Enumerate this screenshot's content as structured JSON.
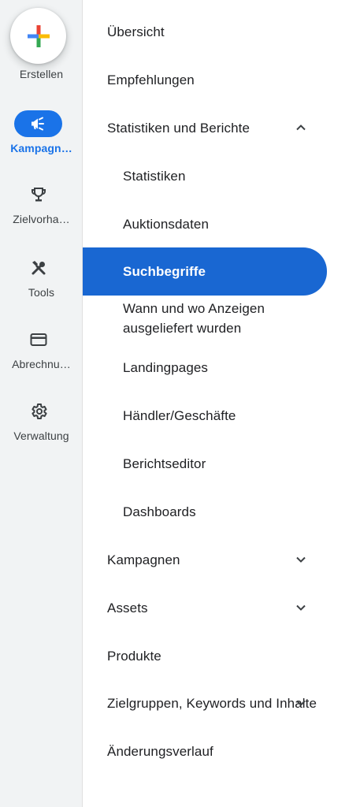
{
  "rail": {
    "create_label": "Erstellen",
    "items": [
      {
        "label": "Kampagn…",
        "icon": "megaphone-icon",
        "active": true
      },
      {
        "label": "Zielvorha…",
        "icon": "trophy-icon",
        "active": false
      },
      {
        "label": "Tools",
        "icon": "tools-icon",
        "active": false
      },
      {
        "label": "Abrechnu…",
        "icon": "credit-card-icon",
        "active": false
      },
      {
        "label": "Verwaltung",
        "icon": "gear-icon",
        "active": false
      }
    ]
  },
  "menu": {
    "items": [
      {
        "label": "Übersicht"
      },
      {
        "label": "Empfehlungen"
      },
      {
        "label": "Statistiken und Berichte",
        "expanded": true
      },
      {
        "label": "Statistiken"
      },
      {
        "label": "Auktionsdaten"
      },
      {
        "label": "Suchbegriffe",
        "selected": true
      },
      {
        "label": "Wann und wo Anzeigen ausgeliefert wurden"
      },
      {
        "label": "Landingpages"
      },
      {
        "label": "Händler/Geschäfte"
      },
      {
        "label": "Berichtseditor"
      },
      {
        "label": "Dashboards"
      },
      {
        "label": "Kampagnen",
        "expanded": false
      },
      {
        "label": "Assets",
        "expanded": false
      },
      {
        "label": "Produkte"
      },
      {
        "label": "Zielgruppen, Keywords und Inhalte",
        "expanded": false
      },
      {
        "label": "Änderungsverlauf"
      }
    ]
  },
  "colors": {
    "accent": "#1a73e8",
    "selected_bg": "#1967d2",
    "rail_bg": "#f1f3f4",
    "google_blue": "#4285f4",
    "google_red": "#ea4335",
    "google_yellow": "#fbbc04",
    "google_green": "#34a853"
  }
}
